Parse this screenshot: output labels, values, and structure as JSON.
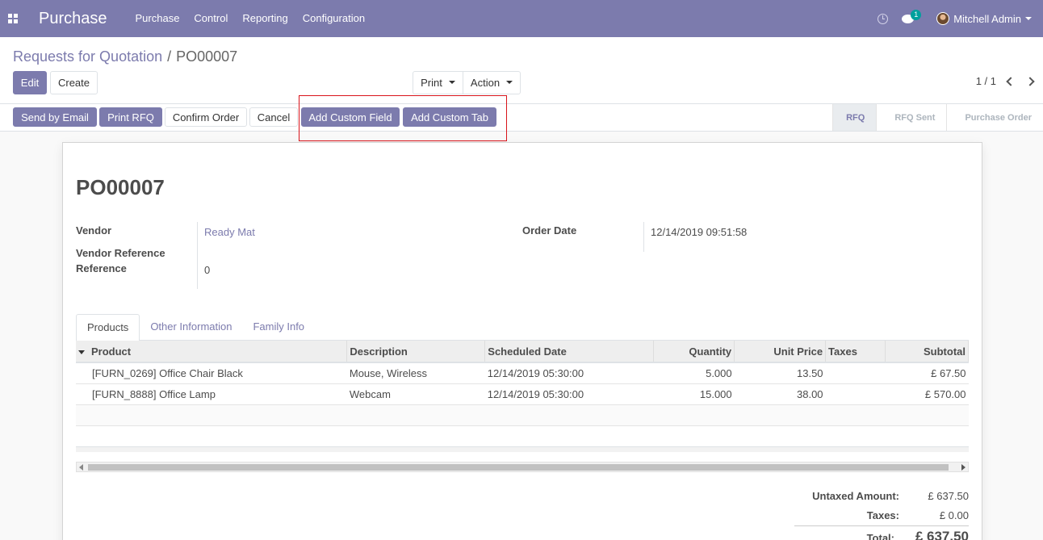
{
  "navbar": {
    "brand": "Purchase",
    "menu": [
      "Purchase",
      "Control",
      "Reporting",
      "Configuration"
    ],
    "messages_count": "1",
    "user_name": "Mitchell Admin"
  },
  "breadcrumb": {
    "parent": "Requests for Quotation",
    "separator": "/",
    "current": "PO00007"
  },
  "buttons": {
    "edit": "Edit",
    "create": "Create",
    "print": "Print",
    "action": "Action"
  },
  "pager": {
    "value": "1 / 1"
  },
  "statusbar": {
    "send_email": "Send by Email",
    "print_rfq": "Print RFQ",
    "confirm_order": "Confirm Order",
    "cancel": "Cancel",
    "add_custom_field": "Add Custom Field",
    "add_custom_tab": "Add Custom Tab",
    "stages": [
      "RFQ",
      "RFQ Sent",
      "Purchase Order"
    ],
    "active_stage": "RFQ"
  },
  "form": {
    "title": "PO00007",
    "vendor_label": "Vendor",
    "vendor_value": "Ready Mat",
    "vendor_ref_label": "Vendor Reference",
    "reference_label": "Reference",
    "reference_value": "0",
    "order_date_label": "Order Date",
    "order_date_value": "12/14/2019 09:51:58"
  },
  "tabs": [
    "Products",
    "Other Information",
    "Family Info"
  ],
  "table": {
    "headers": [
      "Product",
      "Description",
      "Scheduled Date",
      "Quantity",
      "Unit Price",
      "Taxes",
      "Subtotal"
    ],
    "rows": [
      [
        "[FURN_0269] Office Chair Black",
        "Mouse, Wireless",
        "12/14/2019 05:30:00",
        "5.000",
        "13.50",
        "",
        "£ 67.50"
      ],
      [
        "[FURN_8888] Office Lamp",
        "Webcam",
        "12/14/2019 05:30:00",
        "15.000",
        "38.00",
        "",
        "£ 570.00"
      ]
    ]
  },
  "totals": {
    "untaxed_label": "Untaxed Amount:",
    "untaxed_value": "£ 637.50",
    "taxes_label": "Taxes:",
    "taxes_value": "£ 0.00",
    "total_label": "Total:",
    "total_value": "£ 637.50"
  },
  "colors": {
    "brand": "#7c7bad",
    "highlight": "#d9141b"
  }
}
